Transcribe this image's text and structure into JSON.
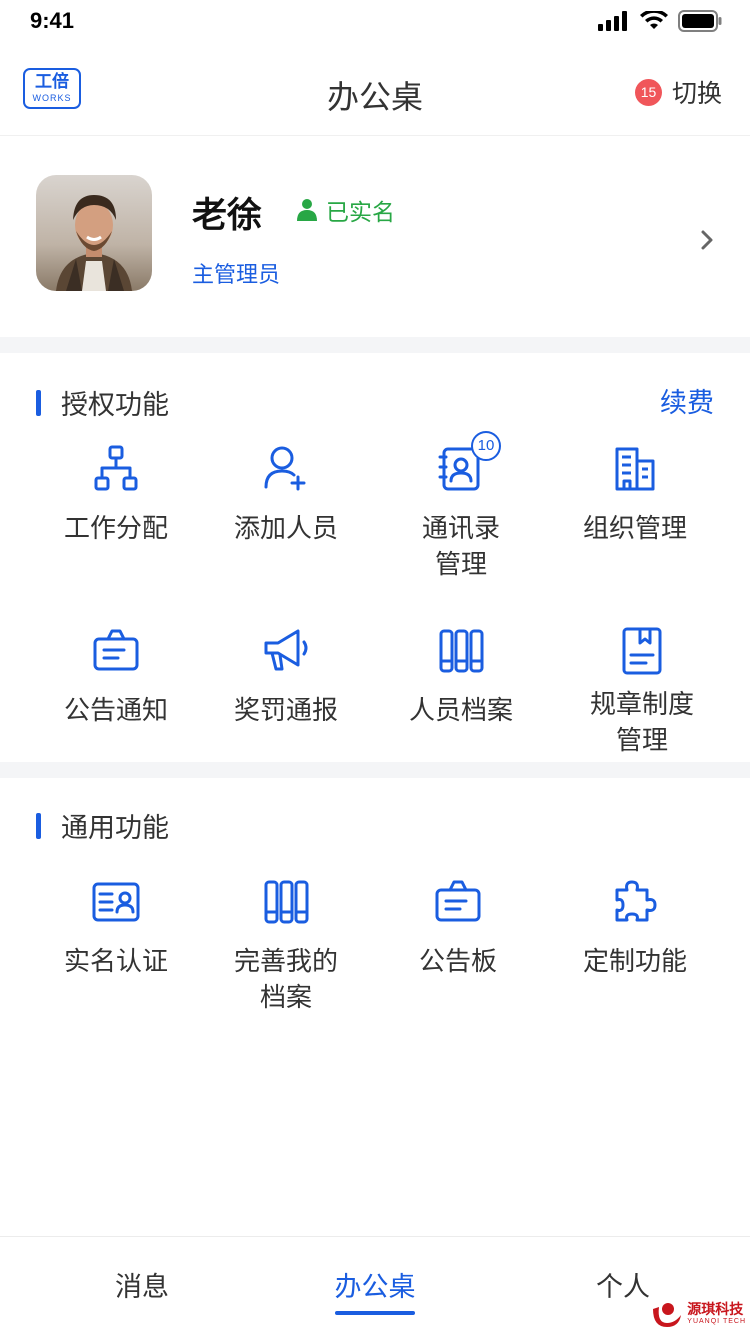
{
  "status_bar": {
    "time": "9:41"
  },
  "nav": {
    "logo_main": "工倍",
    "logo_sub": "WORKS",
    "title": "办公桌",
    "switch_badge": "15",
    "switch_label": "切换"
  },
  "profile": {
    "name": "老徐",
    "verified_label": "已实名",
    "role": "主管理员"
  },
  "authorized": {
    "title": "授权功能",
    "action": "续费",
    "items": [
      {
        "label": "工作分配",
        "icon": "org-chart-icon"
      },
      {
        "label": "添加人员",
        "icon": "add-person-icon"
      },
      {
        "label": "通讯录\n管理",
        "icon": "contacts-icon",
        "badge": "10"
      },
      {
        "label": "组织管理",
        "icon": "building-icon"
      },
      {
        "label": "公告通知",
        "icon": "notice-board-icon"
      },
      {
        "label": "奖罚通报",
        "icon": "megaphone-icon"
      },
      {
        "label": "人员档案",
        "icon": "archive-binders-icon"
      },
      {
        "label": "规章制度\n管理",
        "icon": "rule-book-icon"
      }
    ]
  },
  "general": {
    "title": "通用功能",
    "items": [
      {
        "label": "实名认证",
        "icon": "id-card-icon"
      },
      {
        "label": "完善我的\n档案",
        "icon": "archive-binders-icon"
      },
      {
        "label": "公告板",
        "icon": "notice-board-icon"
      },
      {
        "label": "定制功能",
        "icon": "puzzle-icon"
      }
    ]
  },
  "tab_bar": {
    "tabs": [
      {
        "label": "消息",
        "active": false
      },
      {
        "label": "办公桌",
        "active": true
      },
      {
        "label": "个人",
        "active": false
      }
    ]
  },
  "watermark": {
    "text": "源琪科技",
    "sub": "YUANQI TECH"
  },
  "colors": {
    "accent": "#1a5de0",
    "verified": "#28a745",
    "badge": "#f0565a"
  }
}
